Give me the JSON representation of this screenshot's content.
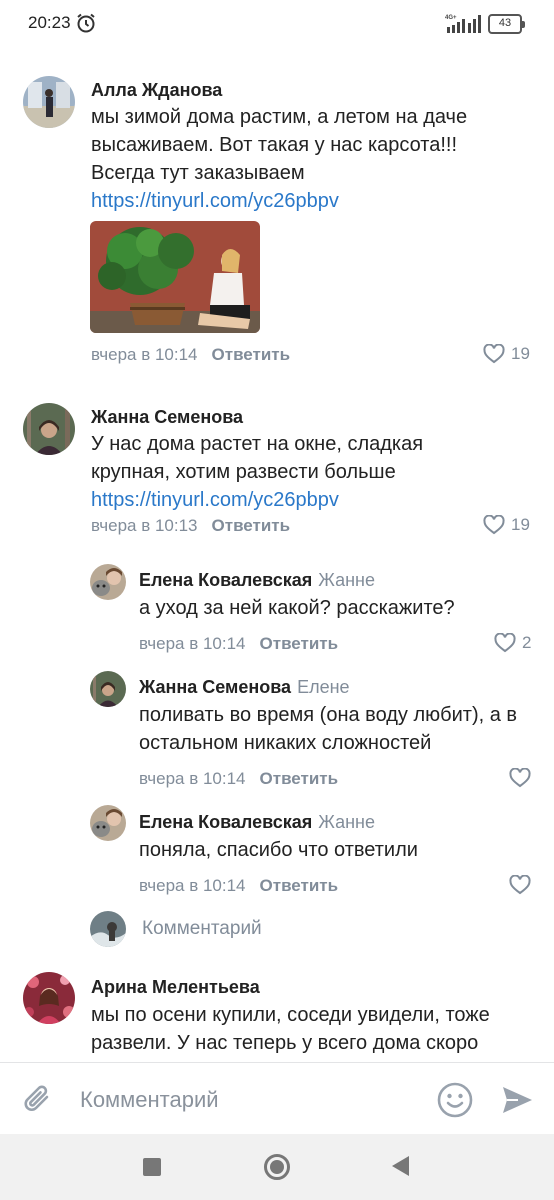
{
  "status_bar": {
    "time": "20:23",
    "network": "4G+",
    "battery": "43"
  },
  "comments": [
    {
      "author": "Алла Жданова",
      "text": "мы зимой дома растим, а летом на даче высаживаем. Вот такая у нас карсота!!! Всегда тут заказываем ",
      "link": "https://tinyurl.com/yc26pbpv",
      "time": "вчера в 10:14",
      "reply_label": "Ответить",
      "likes": "19"
    },
    {
      "author": "Жанна Семенова",
      "text": "У нас дома растет на окне, сладкая крупная, хотим развести больше",
      "link": "https://tinyurl.com/yc26pbpv",
      "time": "вчера в 10:13",
      "reply_label": "Ответить",
      "likes": "19"
    }
  ],
  "replies": [
    {
      "author": "Елена Ковалевская",
      "reply_to": "Жанне",
      "text": "а уход за ней какой? расскажите?",
      "time": "вчера в 10:14",
      "reply_label": "Ответить",
      "likes": "2"
    },
    {
      "author": "Жанна Семенова",
      "reply_to": "Елене",
      "text": "поливать во время (она воду любит), а в остальном никаких сложностей",
      "time": "вчера в 10:14",
      "reply_label": "Ответить",
      "likes": ""
    },
    {
      "author": "Елена Ковалевская",
      "reply_to": "Жанне",
      "text": "поняла, спасибо что ответили",
      "time": "вчера в 10:14",
      "reply_label": "Ответить",
      "likes": ""
    }
  ],
  "thread_reply": {
    "placeholder": "Комментарий"
  },
  "last_comment": {
    "author": "Арина Мелентьева",
    "text": "мы по осени купили, соседи увидели, тоже развели. У нас теперь у всего дома скоро"
  },
  "composer": {
    "placeholder": "Комментарий"
  },
  "icons": {
    "alarm": "alarm-icon",
    "signal": "signal-icon",
    "battery": "battery-icon",
    "like": "heart-icon",
    "attach": "paperclip-icon",
    "emoji": "smile-icon",
    "send": "send-icon"
  },
  "colors": {
    "link": "#2a78c9",
    "secondary_text": "#818c99",
    "navbar": "#f1f1f1"
  }
}
